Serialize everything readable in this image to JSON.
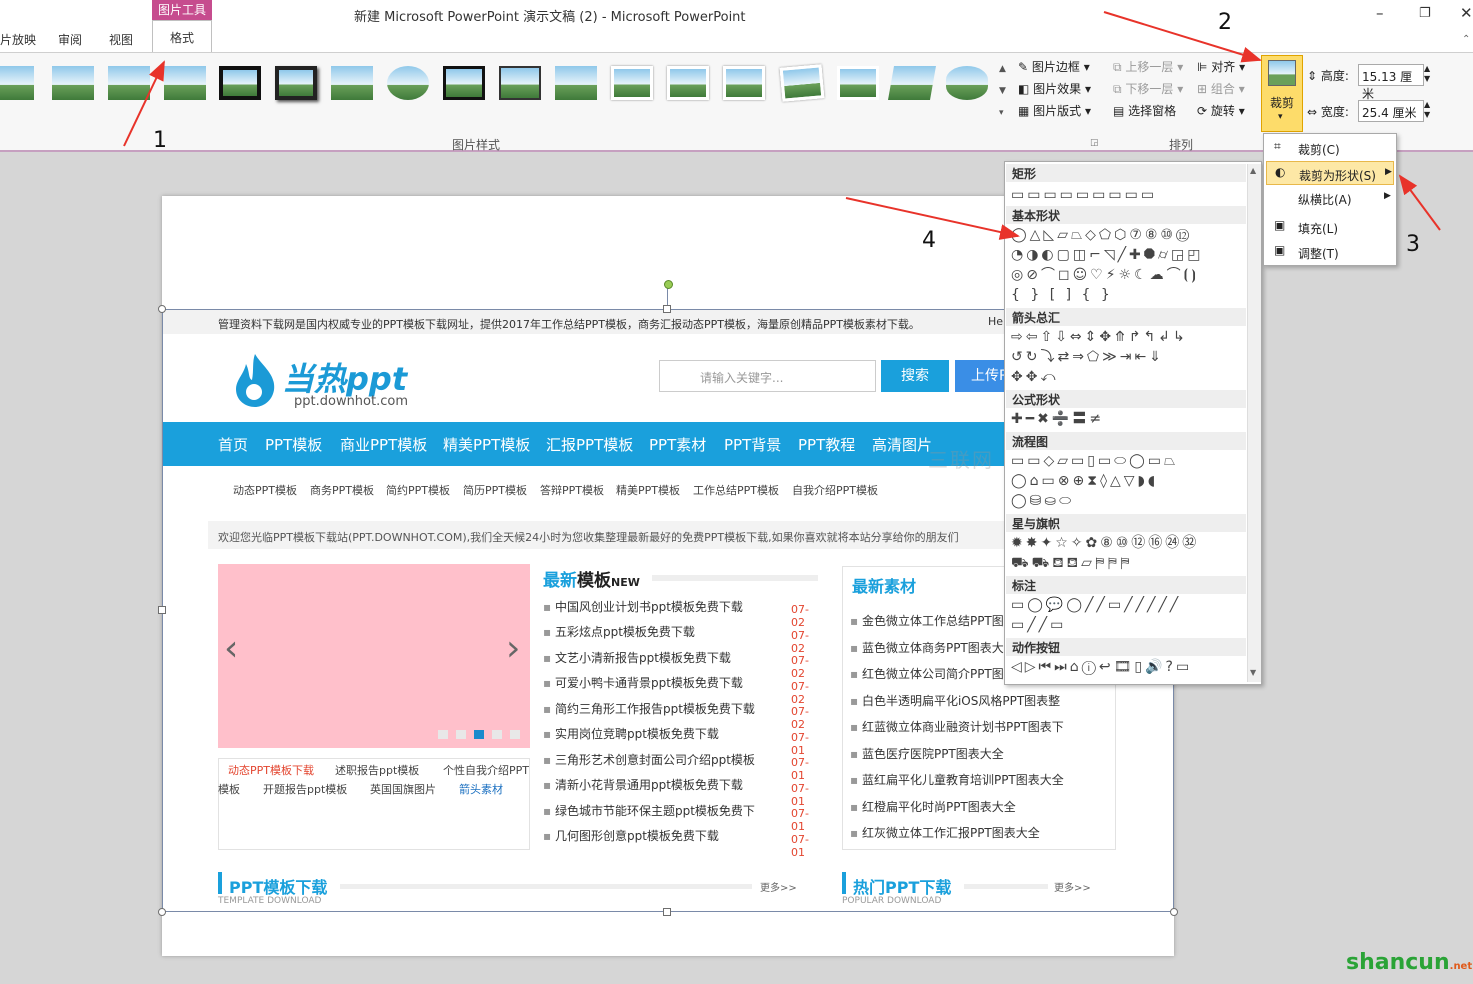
{
  "window": {
    "title": "新建 Microsoft PowerPoint 演示文稿 (2)  -  Microsoft PowerPoint",
    "tabs": [
      "片放映",
      "审阅",
      "视图"
    ],
    "context_group": "图片工具",
    "active_tab": "格式",
    "minimize": "–",
    "restore": "❐",
    "close": "✕"
  },
  "ribbon": {
    "picture_styles_label": "图片样式",
    "border": "图片边框",
    "effects": "图片效果",
    "layout": "图片版式",
    "arrange_label": "排列",
    "bring_forward": "上移一层",
    "send_backward": "下移一层",
    "selection_pane": "选择窗格",
    "align": "对齐",
    "group": "组合",
    "rotate": "旋转",
    "crop": "裁剪",
    "height_label": "高度:",
    "height_value": "15.13 厘米",
    "width_label": "宽度:",
    "width_value": "25.4 厘米"
  },
  "crop_menu": {
    "items": [
      "裁剪(C)",
      "裁剪为形状(S)",
      "纵横比(A)",
      "填充(L)",
      "调整(T)"
    ]
  },
  "shapes_panel": {
    "sections": [
      "矩形",
      "基本形状",
      "箭头总汇",
      "公式形状",
      "流程图",
      "星与旗帜",
      "标注",
      "动作按钮"
    ],
    "rows": {
      "rect": "▭▭▭▭▭▭▭▭▭",
      "basic1": "◯△◺▱⏢◇⬠⬡⑦⑧⑩⑫",
      "basic2": "◔◑◐▢◫⌐◹╱✚⯃⌭◲◰",
      "basic3": "◎⊘⌒◻☺♡⚡☼☾☁⌒⦗⦘",
      "basic4": "{ } [ ] { }",
      "arrow1": "⇨⇦⇧⇩⇔⇕✥⤊↱↰↲↳",
      "arrow2": "↺↻⤵⇄⇒⬠≫⇥⇤⇓",
      "arrow3": "✥✥⤺",
      "math": "✚━✖➗〓≠",
      "flow1": "▭▭◇▱▭▯▭⬭◯▭⏢",
      "flow2": "◯⌂▭⊗⊕⧗◊△▽◗◖",
      "flow3": "◯⛁⛀⬭",
      "star1": "✹✸✦☆✧✿⑧⑩⑫⑯㉔㉜",
      "star2": "⛟⛟⛾⛾▱⛿⛿⛿",
      "callout1": "▭◯💬◯╱╱▭╱╱╱╱╱",
      "callout2": "▭╱╱▭",
      "action": "◁▷⏮⏭⌂ⓘ↩🎞▯🔊?▭"
    }
  },
  "slide": {
    "topbar": "管理资料下载网是国内权威专业的PPT模板下载网址，提供2017年工作总结PPT模板，商务汇报动态PPT模板，海量原创精品PPT模板素材下载。",
    "topbar_right": "He",
    "logo_text": "当热ppt",
    "logo_url": "ppt.downhot.com",
    "search_placeholder": "请输入关键字...",
    "search_btn": "搜索",
    "upload_btn": "上传P",
    "nav": [
      "首页",
      "PPT模板",
      "商业PPT模板",
      "精美PPT模板",
      "汇报PPT模板",
      "PPT素材",
      "PPT背景",
      "PPT教程",
      "高清图片"
    ],
    "subnav": [
      "动态PPT模板",
      "商务PPT模板",
      "简约PPT模板",
      "简历PPT模板",
      "答辩PPT模板",
      "精美PPT模板",
      "工作总结PPT模板",
      "自我介绍PPT模板"
    ],
    "welcome": "欢迎您光临PPT模板下载站(PPT.DOWNHOT.COM),我们全天候24小时为您收集整理最新最好的免费PPT模板下载,如果你喜欢就将本站分享给你的朋友们",
    "latest_title": "最新",
    "latest_title2": "模板",
    "latest_new": "NEW",
    "latest_items": [
      "中国风创业计划书ppt模板免费下载",
      "五彩炫点ppt模板免费下载",
      "文艺小清新报告ppt模板免费下载",
      "可爱小鸭卡通背景ppt模板免费下载",
      "简约三角形工作报告ppt模板免费下载",
      "实用岗位竞聘ppt模板免费下载",
      "三角形艺术创意封面公司介绍ppt模板",
      "清新小花背景通用ppt模板免费下载",
      "绿色城市节能环保主题ppt模板免费下",
      "几何图形创意ppt模板免费下载"
    ],
    "latest_dates": [
      "07-02",
      "07-02",
      "07-02",
      "07-02",
      "07-02",
      "07-01",
      "07-01",
      "07-01",
      "07-01",
      "07-01"
    ],
    "material_title": "最新素材",
    "material_items": [
      "金色微立体工作总结PPT图",
      "蓝色微立体商务PPT图表大",
      "红色微立体公司简介PPT图",
      "白色半透明扁平化iOS风格PPT图表整",
      "红蓝微立体商业融资计划书PPT图表下",
      "蓝色医疗医院PPT图表大全",
      "蓝红扁平化儿童教育培训PPT图表大全",
      "红橙扁平化时尚PPT图表大全",
      "红灰微立体工作汇报PPT图表大全"
    ],
    "tags_row1": [
      "动态PPT模板下载",
      "述职报告ppt模板",
      "个性自我介绍PPT"
    ],
    "tags_row2": [
      "模板",
      "开题报告ppt模板",
      "英国国旗图片",
      "箭头素材"
    ],
    "prev": "‹",
    "next": "›",
    "dl_title": "PPT模板下载",
    "dl_sub": "TEMPLATE DOWNLOAD",
    "hot_title": "热门PPT下载",
    "hot_sub": "POPULAR DOWNLOAD",
    "more": "更多>>"
  },
  "annotations": [
    "1",
    "2",
    "3",
    "4"
  ],
  "watermark": "三联网 3LIAN.COM",
  "brand": "shancun",
  "brand_suffix": ".net",
  "colors": {
    "nav_blue": "#1aa0dc",
    "context_pink": "#c64c8e",
    "annotation_red": "#e8332a",
    "crop_yellow": "#fddc6a",
    "date_red": "#e3452f",
    "carousel_pink": "#ffc0cb"
  }
}
